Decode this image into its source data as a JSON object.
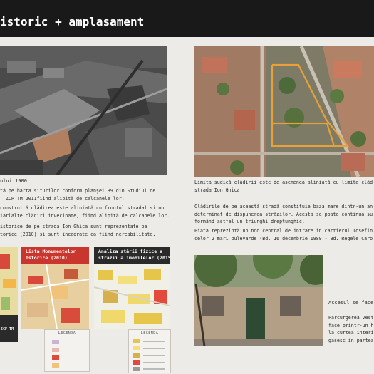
{
  "header": {
    "title": "istoric + amplasament"
  },
  "left": {
    "caption_year": "ului 1900",
    "paragraph1": [
      "tă pe harta siturilor conform planșei 39 din Studiul de",
      " – ZCP TM 2011fiind alipită de calcanele lor."
    ],
    "paragraph2": [
      "construită clădirea este aliniată cu frontul stradal si nu",
      "iarlalte clădiri invecinate, fiind alipită de calcanele lor."
    ],
    "paragraph3": [
      "istorice de pe strada Ion Ghica sunt reprezentate pe",
      "torice (2010) și sunt încadrate ca fiind nereabilitate."
    ],
    "map1": {
      "label": "2CP TM"
    },
    "map2": {
      "label": "Lista Monumentelor\nIstorice (2010)",
      "legend_title": "LEGENDA"
    },
    "map3": {
      "label": "Analiza stării fizice a\nstrazii a imobilelor (2015)",
      "legend_title": "LEGENDA"
    }
  },
  "right": {
    "caption": [
      "Limita sudică clădirii este de asemenea aliniată cu limita clăd",
      "strada Ion Ghica."
    ],
    "paragraph1": [
      "Clădirile de pe această stradă constituie baza mare dintr-un an",
      "determinat de dispunerea străzilor. Acesta se poate continua su",
      "formând astfel un triunghi dreptunghic."
    ],
    "paragraph2": [
      "Piata reprezintă un nod central de intrare in cartierul Iosefin",
      "celor 2 mari bulevarde (Bd. 16 decembrie 1989 - Bd. Regele Caro"
    ],
    "access_title": "Accesul se face",
    "access_text": [
      "Parcurgerea vest",
      "face printr-un h",
      "la curtea interi",
      "gasesc in partea"
    ]
  },
  "colors": {
    "header_bg": "#191919",
    "outline_orange": "#e8a13a",
    "page_bg": "#ecebe8"
  }
}
